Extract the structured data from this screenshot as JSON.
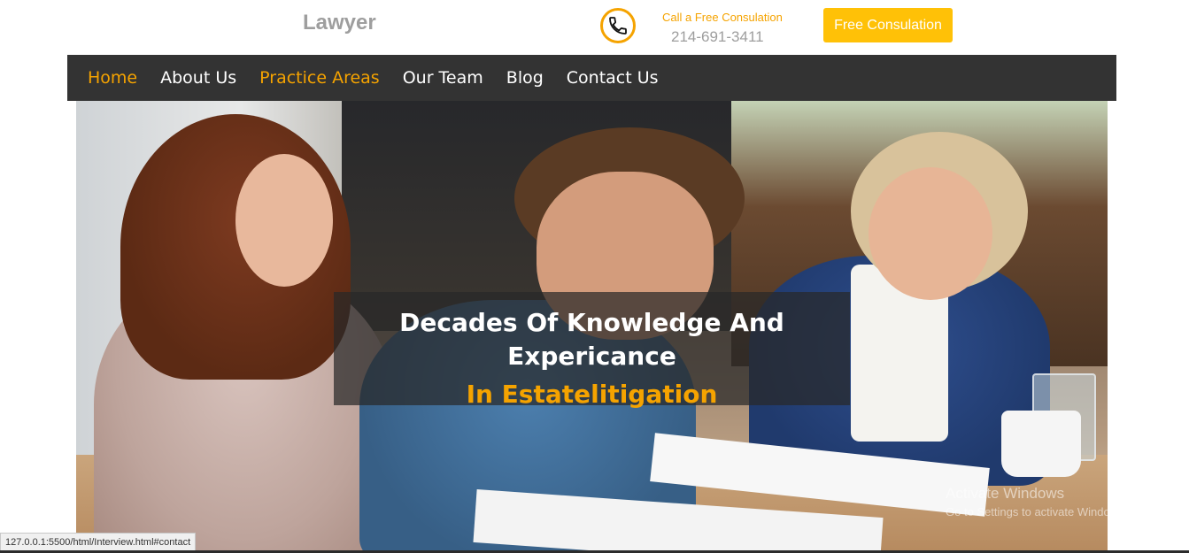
{
  "header": {
    "logo": "Lawyer",
    "call_text": "Call a Free Consulation",
    "phone_number": "214-691-3411",
    "cta_label": "Free Consulation",
    "phone_icon": "phone-icon"
  },
  "nav": {
    "items": [
      {
        "label": "Home",
        "active": true
      },
      {
        "label": "About Us",
        "active": false
      },
      {
        "label": "Practice Areas",
        "active": true
      },
      {
        "label": "Our Team",
        "active": false
      },
      {
        "label": "Blog",
        "active": false
      },
      {
        "label": "Contact Us",
        "active": false
      }
    ]
  },
  "hero": {
    "line1": "Decades Of Knowledge And",
    "line2": "Expericance",
    "line3": "In Estatelitigation"
  },
  "watermark": {
    "title": "Activate Windows",
    "subtitle": "Go to Settings to activate Windows."
  },
  "status_bar": {
    "url": "127.0.0.1:5500/html/Interview.html#contact"
  },
  "colors": {
    "accent": "#f5a300",
    "button": "#ffc107",
    "nav_bg": "#333333"
  }
}
